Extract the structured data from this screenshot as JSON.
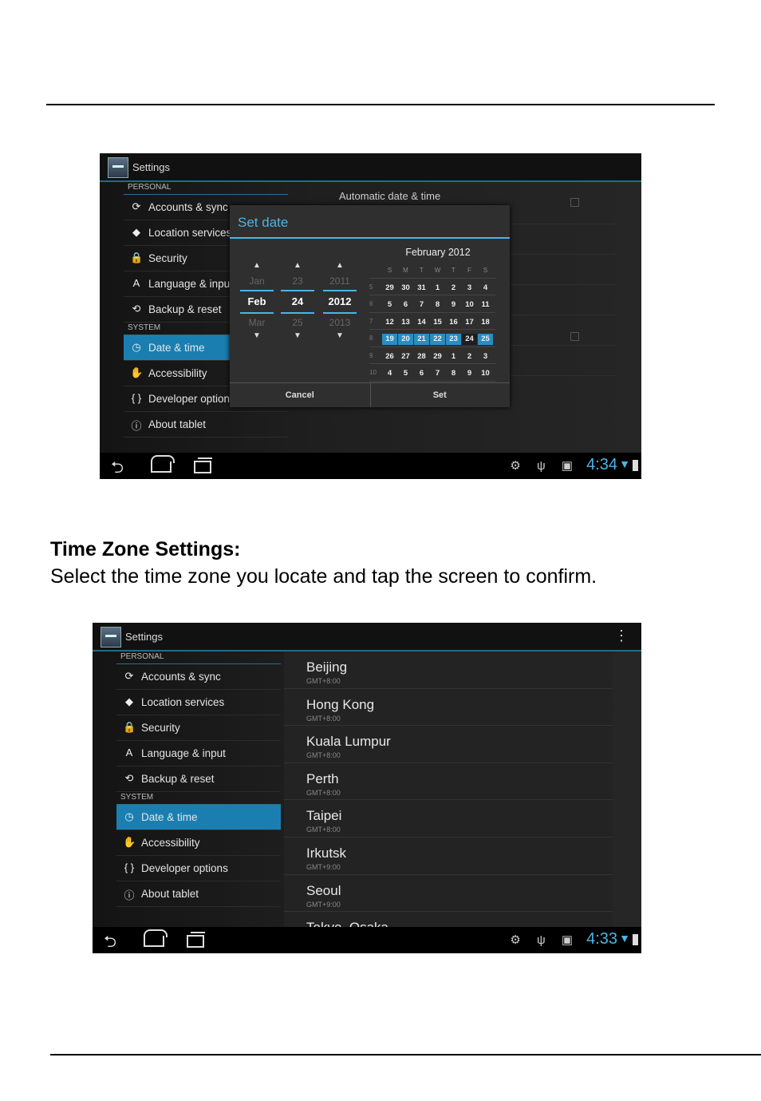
{
  "doc": {
    "heading": "Time Zone Settings:",
    "body": "Select the time zone you locate and tap the screen to confirm."
  },
  "shot1": {
    "app_title": "Settings",
    "sections": {
      "personal": "PERSONAL",
      "system": "SYSTEM"
    },
    "personal_items": [
      {
        "label": "Accounts & sync",
        "icon": "sync-icon",
        "glyph": "⟳"
      },
      {
        "label": "Location services",
        "icon": "location-icon",
        "glyph": "◆"
      },
      {
        "label": "Security",
        "icon": "lock-icon",
        "glyph": "🔒"
      },
      {
        "label": "Language & input",
        "icon": "keyboard-icon",
        "glyph": "A"
      },
      {
        "label": "Backup & reset",
        "icon": "backup-icon",
        "glyph": "⟲"
      }
    ],
    "system_items": [
      {
        "label": "Date & time",
        "icon": "clock-icon",
        "glyph": "◷"
      },
      {
        "label": "Accessibility",
        "icon": "hand-icon",
        "glyph": "✋"
      },
      {
        "label": "Developer options",
        "icon": "braces-icon",
        "glyph": "{ }"
      },
      {
        "label": "About tablet",
        "icon": "info-icon",
        "glyph": "ⓘ"
      }
    ],
    "auto_label": "Automatic date & time",
    "dialog": {
      "title": "Set date",
      "month": {
        "prev": "Jan",
        "current": "Feb",
        "next": "Mar"
      },
      "day": {
        "prev": "23",
        "current": "24",
        "next": "25"
      },
      "year": {
        "prev": "2011",
        "current": "2012",
        "next": "2013"
      },
      "calendar_title": "February 2012",
      "weekdays": [
        "S",
        "M",
        "T",
        "W",
        "T",
        "F",
        "S"
      ],
      "weeks": [
        {
          "num": "5",
          "days": [
            "29",
            "30",
            "31",
            "1",
            "2",
            "3",
            "4"
          ]
        },
        {
          "num": "6",
          "days": [
            "5",
            "6",
            "7",
            "8",
            "9",
            "10",
            "11"
          ]
        },
        {
          "num": "7",
          "days": [
            "12",
            "13",
            "14",
            "15",
            "16",
            "17",
            "18"
          ]
        },
        {
          "num": "8",
          "days": [
            "19",
            "20",
            "21",
            "22",
            "23",
            "24",
            "25"
          ]
        },
        {
          "num": "9",
          "days": [
            "26",
            "27",
            "28",
            "29",
            "1",
            "2",
            "3"
          ]
        },
        {
          "num": "10",
          "days": [
            "4",
            "5",
            "6",
            "7",
            "8",
            "9",
            "10"
          ]
        }
      ],
      "cancel": "Cancel",
      "set": "Set"
    },
    "time": "4:34"
  },
  "shot2": {
    "app_title": "Settings",
    "sections": {
      "personal": "PERSONAL",
      "system": "SYSTEM"
    },
    "personal_items": [
      {
        "label": "Accounts & sync",
        "icon": "sync-icon",
        "glyph": "⟳"
      },
      {
        "label": "Location services",
        "icon": "location-icon",
        "glyph": "◆"
      },
      {
        "label": "Security",
        "icon": "lock-icon",
        "glyph": "🔒"
      },
      {
        "label": "Language & input",
        "icon": "keyboard-icon",
        "glyph": "A"
      },
      {
        "label": "Backup & reset",
        "icon": "backup-icon",
        "glyph": "⟲"
      }
    ],
    "system_items": [
      {
        "label": "Date & time",
        "icon": "clock-icon",
        "glyph": "◷"
      },
      {
        "label": "Accessibility",
        "icon": "hand-icon",
        "glyph": "✋"
      },
      {
        "label": "Developer options",
        "icon": "braces-icon",
        "glyph": "{ }"
      },
      {
        "label": "About tablet",
        "icon": "info-icon",
        "glyph": "ⓘ"
      }
    ],
    "timezones": [
      {
        "name": "Beijing",
        "offset": "GMT+8:00"
      },
      {
        "name": "Hong Kong",
        "offset": "GMT+8:00"
      },
      {
        "name": "Kuala Lumpur",
        "offset": "GMT+8:00"
      },
      {
        "name": "Perth",
        "offset": "GMT+8:00"
      },
      {
        "name": "Taipei",
        "offset": "GMT+8:00"
      },
      {
        "name": "Irkutsk",
        "offset": "GMT+9:00"
      },
      {
        "name": "Seoul",
        "offset": "GMT+9:00"
      },
      {
        "name": "Tokyo, Osaka",
        "offset": ""
      }
    ],
    "time": "4:33"
  },
  "colors": {
    "accent": "#4ab5e6",
    "selected": "#1a7fb0"
  }
}
